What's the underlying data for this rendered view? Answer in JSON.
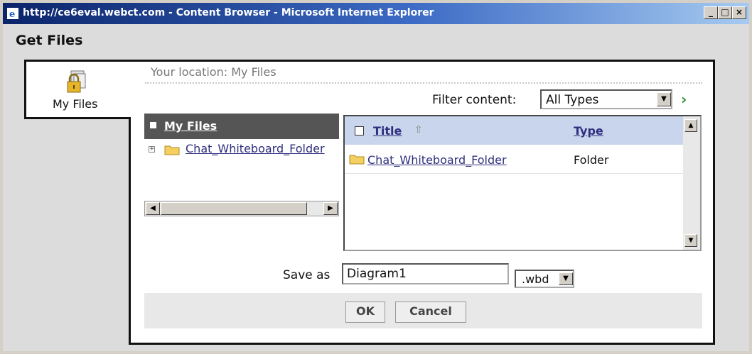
{
  "window": {
    "title": "http://ce6eval.webct.com - Content Browser - Microsoft Internet Explorer",
    "minimize": "_",
    "maximize": "□",
    "close": "×"
  },
  "page": {
    "heading": "Get Files"
  },
  "tab": {
    "label": "My Files",
    "icon": "my-files-lock-icon"
  },
  "location": {
    "text": "Your location: My Files"
  },
  "filter": {
    "label": "Filter content:",
    "selected": "All Types",
    "go_icon": "chevron-right-icon"
  },
  "tree": {
    "root_label": "My Files",
    "items": [
      {
        "label": "Chat_Whiteboard_Folder",
        "expander": "⊞"
      }
    ]
  },
  "list": {
    "columns": {
      "title": "Title",
      "type": "Type"
    },
    "rows": [
      {
        "title": "Chat_Whiteboard_Folder",
        "type": "Folder"
      }
    ]
  },
  "save": {
    "label": "Save as",
    "value": "Diagram1",
    "extension": ".wbd"
  },
  "buttons": {
    "ok": "OK",
    "cancel": "Cancel"
  },
  "colors": {
    "titlebar_start": "#0a246a",
    "link": "#2f2f7f",
    "header_row": "#c9d5ec",
    "tree_header": "#555555",
    "go_arrow": "#2e8b2e"
  }
}
